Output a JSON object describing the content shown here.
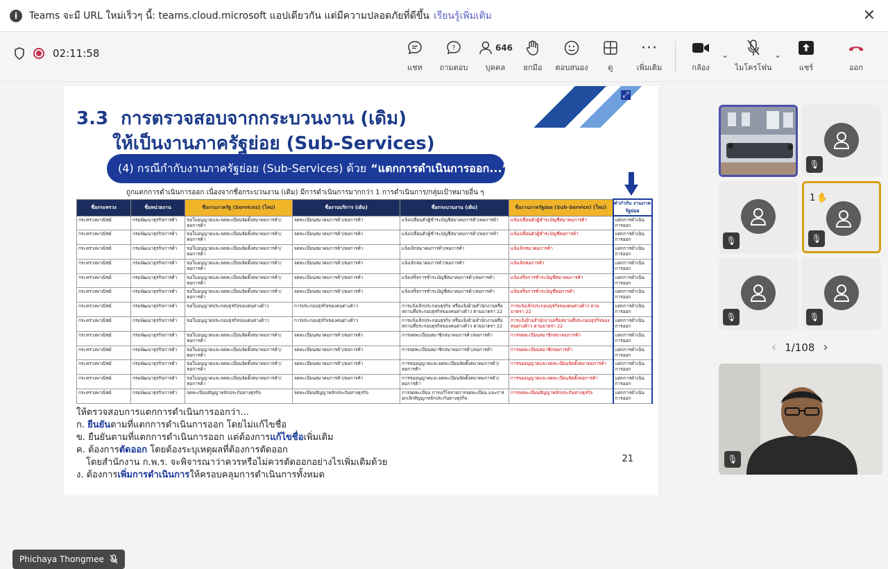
{
  "banner": {
    "message": "Teams จะมี URL ใหม่เร็วๆ นี้: teams.cloud.microsoft แอปเดียวกัน แต่มีความปลอดภัยที่ดีขึ้น",
    "link": "เรียนรู้เพิ่มเติม"
  },
  "meeting": {
    "timer": "02:11:58",
    "people_count": "646"
  },
  "toolbar": {
    "chat": "แชท",
    "qa": "ถามตอบ",
    "people": "บุคคล",
    "raise": "ยกมือ",
    "react": "ตอบสนอง",
    "view": "ดู",
    "more": "เพิ่มเติม",
    "camera": "กล้อง",
    "mic": "ไมโครโฟน",
    "share": "แชร์",
    "leave": "ออก"
  },
  "slide": {
    "title_num": "3.3",
    "title1": "การตรวจสอบจากกระบวนงาน (เดิม)",
    "title2": "ให้เป็นงานภาครัฐย่อย (Sub-Services)",
    "pill": "(4) กรณีกำกับงานภาครัฐย่อย (Sub-Services) ด้วย",
    "pill_bold": "“แตกการดำเนินการออก...”",
    "subtitle": "ถูกแตกการดำเนินการออก เนื่องจากชื่อกระบวนงาน (เดิม) มีการดำเนินการมากกว่า 1 การดำเนินการ/กลุ่มเป้าหมายอื่น ๆ",
    "headers": [
      "ชื่อกระทรวง",
      "ชื่อหน่วยงาน",
      "ชื่องานภาครัฐ (Services) (ใหม่)",
      "ชื่องานบริการ (เดิม)",
      "ชื่อกระบวนงาน (เดิม)",
      "ชื่องานภาครัฐย่อย (Sub-Service) (ใหม่)",
      "คำกำกับ งานภาครัฐย่อย"
    ],
    "rows": [
      [
        "กระทรวงพาณิชย์",
        "กรมพัฒนาธุรกิจการค้า",
        "ขอใบอนุญาตและจดทะเบียนจัดตั้งสมาคมการค้า/หอการค้า",
        "จดทะเบียนสมาคมการค้า/หอการค้า",
        "แจ้งเปลี่ยนตัวผู้ชำระบัญชีสมาคมการค้า/หอการค้า",
        "แจ้งเปลี่ยนตัวผู้ชำระบัญชีสมาคมการค้า",
        "แตกการดำเนินการออก"
      ],
      [
        "กระทรวงพาณิชย์",
        "กรมพัฒนาธุรกิจการค้า",
        "ขอใบอนุญาตและจดทะเบียนจัดตั้งสมาคมการค้า/หอการค้า",
        "จดทะเบียนสมาคมการค้า/หอการค้า",
        "แจ้งเปลี่ยนตัวผู้ชำระบัญชีสมาคมการค้า/หอการค้า",
        "แจ้งเปลี่ยนตัวผู้ชำระบัญชีหอการค้า",
        "แตกการดำเนินการออก"
      ],
      [
        "กระทรวงพาณิชย์",
        "กรมพัฒนาธุรกิจการค้า",
        "ขอใบอนุญาตและจดทะเบียนจัดตั้งสมาคมการค้า/หอการค้า",
        "จดทะเบียนสมาคมการค้า/หอการค้า",
        "แจ้งเลิกสมาคมการค้า/หอการค้า",
        "แจ้งเลิกสมาคมการค้า",
        "แตกการดำเนินการออก"
      ],
      [
        "กระทรวงพาณิชย์",
        "กรมพัฒนาธุรกิจการค้า",
        "ขอใบอนุญาตและจดทะเบียนจัดตั้งสมาคมการค้า/หอการค้า",
        "จดทะเบียนสมาคมการค้า/หอการค้า",
        "แจ้งเลิกสมาคมการค้า/หอการค้า",
        "แจ้งเลิกหอการค้า",
        "แตกการดำเนินการออก"
      ],
      [
        "กระทรวงพาณิชย์",
        "กรมพัฒนาธุรกิจการค้า",
        "ขอใบอนุญาตและจดทะเบียนจัดตั้งสมาคมการค้า/หอการค้า",
        "จดทะเบียนสมาคมการค้า/หอการค้า",
        "แจ้งเสร็จการชำระบัญชีสมาคมการค้า/หอการค้า",
        "แจ้งเสร็จการชำระบัญชีสมาคมการค้า",
        "แตกการดำเนินการออก"
      ],
      [
        "กระทรวงพาณิชย์",
        "กรมพัฒนาธุรกิจการค้า",
        "ขอใบอนุญาตและจดทะเบียนจัดตั้งสมาคมการค้า/หอการค้า",
        "จดทะเบียนสมาคมการค้า/หอการค้า",
        "แจ้งเสร็จการชำระบัญชีสมาคมการค้า/หอการค้า",
        "แจ้งเสร็จการชำระบัญชีหอการค้า",
        "แตกการดำเนินการออก"
      ],
      [
        "กระทรวงพาณิชย์",
        "กรมพัฒนาธุรกิจการค้า",
        "ขอใบอนุญาตประกอบธุรกิจของคนต่างด้าว",
        "การประกอบธุรกิจของคนต่างด้าว",
        "การแจ้งเลิกประกอบธุรกิจ หรือแจ้งย้ายสำนักงานหรือสถานที่ประกอบธุรกิจของคนต่างด้าว ตามมาตรา 22",
        "การแจ้งเลิกประกอบธุรกิจของคนต่างด้าว ตามมาตรา 22",
        "แตกการดำเนินการออก"
      ],
      [
        "กระทรวงพาณิชย์",
        "กรมพัฒนาธุรกิจการค้า",
        "ขอใบอนุญาตประกอบธุรกิจของคนต่างด้าว",
        "การประกอบธุรกิจของคนต่างด้าว",
        "การแจ้งเลิกประกอบธุรกิจ หรือแจ้งย้ายสำนักงานหรือสถานที่ประกอบธุรกิจของคนต่างด้าว ตามมาตรา 22",
        "การแจ้งย้ายสำนักงานหรือสถานที่ประกอบธุรกิจของคนต่างด้าว ตามมาตรา 22",
        "แตกการดำเนินการออก"
      ],
      [
        "กระทรวงพาณิชย์",
        "กรมพัฒนาธุรกิจการค้า",
        "ขอใบอนุญาตและจดทะเบียนจัดตั้งสมาคมการค้า/หอการค้า",
        "จดทะเบียนสมาคมการค้า/หอการค้า",
        "การจดทะเบียนสมาชิกสมาคมการค้า/หอการค้า",
        "การจดทะเบียนสมาชิกสมาคมการค้า",
        "แตกการดำเนินการออก"
      ],
      [
        "กระทรวงพาณิชย์",
        "กรมพัฒนาธุรกิจการค้า",
        "ขอใบอนุญาตและจดทะเบียนจัดตั้งสมาคมการค้า/หอการค้า",
        "จดทะเบียนสมาคมการค้า/หอการค้า",
        "การจดทะเบียนสมาชิกสมาคมการค้า/หอการค้า",
        "การจดทะเบียนสมาชิกหอการค้า",
        "แตกการดำเนินการออก"
      ],
      [
        "กระทรวงพาณิชย์",
        "กรมพัฒนาธุรกิจการค้า",
        "ขอใบอนุญาตและจดทะเบียนจัดตั้งสมาคมการค้า/หอการค้า",
        "จดทะเบียนสมาคมการค้า/หอการค้า",
        "การขออนุญาตและจดทะเบียนจัดตั้งสมาคมการค้า/หอการค้า",
        "การขออนุญาตและจดทะเบียนจัดตั้งสมาคมการค้า",
        "แตกการดำเนินการออก"
      ],
      [
        "กระทรวงพาณิชย์",
        "กรมพัฒนาธุรกิจการค้า",
        "ขอใบอนุญาตและจดทะเบียนจัดตั้งสมาคมการค้า/หอการค้า",
        "จดทะเบียนสมาคมการค้า/หอการค้า",
        "การขออนุญาตและจดทะเบียนจัดตั้งสมาคมการค้า/หอการค้า",
        "การขออนุญาตและจดทะเบียนจัดตั้งหอการค้า",
        "แตกการดำเนินการออก"
      ],
      [
        "กระทรวงพาณิชย์",
        "กรมพัฒนาธุรกิจการค้า",
        "จดทะเบียนสัญญาหลักประกันทางธุรกิจ",
        "จดทะเบียนสัญญาหลักประกันทางธุรกิจ",
        "การจดทะเบียน การแก้ไขรายการจดทะเบียน และการยกเลิกสัญญาหลักประกันทางธุรกิจ",
        "การจดทะเบียนสัญญาหลักประกันทางธุรกิจ",
        "แตกการดำเนินการออก"
      ]
    ],
    "notes_intro": "ให้ตรวจสอบการแตกการดำเนินการออกว่า...",
    "note1_pre": "ก.",
    "note1_bold": "ยืนยัน",
    "note1_post": "ตามที่แตกการดำเนินการออก โดยไม่แก้ไขชื่อ",
    "note2_pre": "ข. ยืนยันตามที่แตกการดำเนินการออก แต่ต้องการ",
    "note2_bold": "แก้ไขชื่อ",
    "note2_post": "เพิ่มเติม",
    "note3_pre": "ค. ต้องการ",
    "note3_bold": "ตัดออก",
    "note3_post": " โดยต้องระบุเหตุผลที่ต้องการตัดออก",
    "note3b": "โดยสำนักงาน ก.พ.ร. จะพิจารณาว่าควรหรือไม่ควรตัดออกอย่างไรเพิ่มเติมด้วย",
    "note4_pre": "ง. ต้องการ",
    "note4_bold": "เพิ่มการดำเนินการ",
    "note4_post": "ให้ครอบคลุมการดำเนินการทั้งหมด",
    "page_num": "21"
  },
  "presenter_name": "Phichaya Thongmee",
  "gallery": {
    "hand_count": "1",
    "pager": "1/108"
  },
  "colors": {
    "accent": "#5b5fc7",
    "leave": "#c4314b",
    "slide_blue": "#1b3a9a",
    "hand_border": "#d4a017"
  }
}
